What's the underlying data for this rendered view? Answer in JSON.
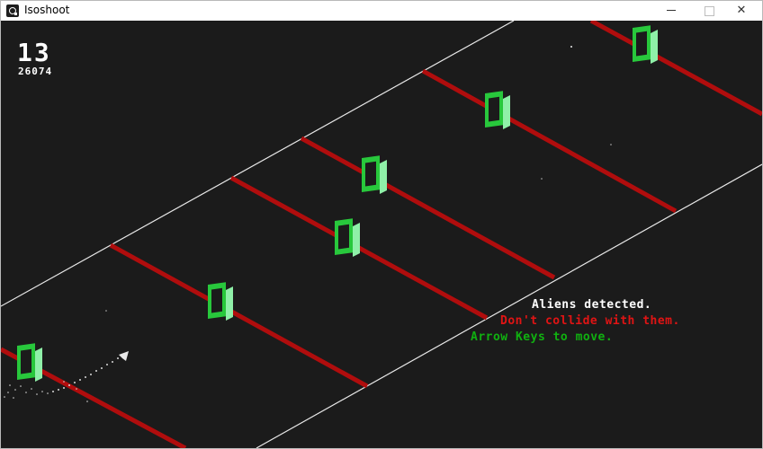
{
  "window": {
    "title": "Isoshoot",
    "minimize_glyph": "",
    "maximize_glyph": "",
    "close_glyph": "✕"
  },
  "hud": {
    "level": "13",
    "score": "26074"
  },
  "messages": [
    {
      "text": "Aliens detected.",
      "color": "#ffffff"
    },
    {
      "text": "Don't collide with them.",
      "color": "#e01414"
    },
    {
      "text": "Arrow Keys to move.",
      "color": "#10b010"
    }
  ],
  "colors": {
    "background": "#1b1b1b",
    "track_edge": "#e8e8e8",
    "lane_line": "#b00d0d",
    "alien_face": "#28c83c",
    "alien_side": "#8ff0a8"
  },
  "icons": {
    "app": "isoshoot-app-icon",
    "player": "player-ship-icon",
    "alien": "alien-frame-icon"
  }
}
